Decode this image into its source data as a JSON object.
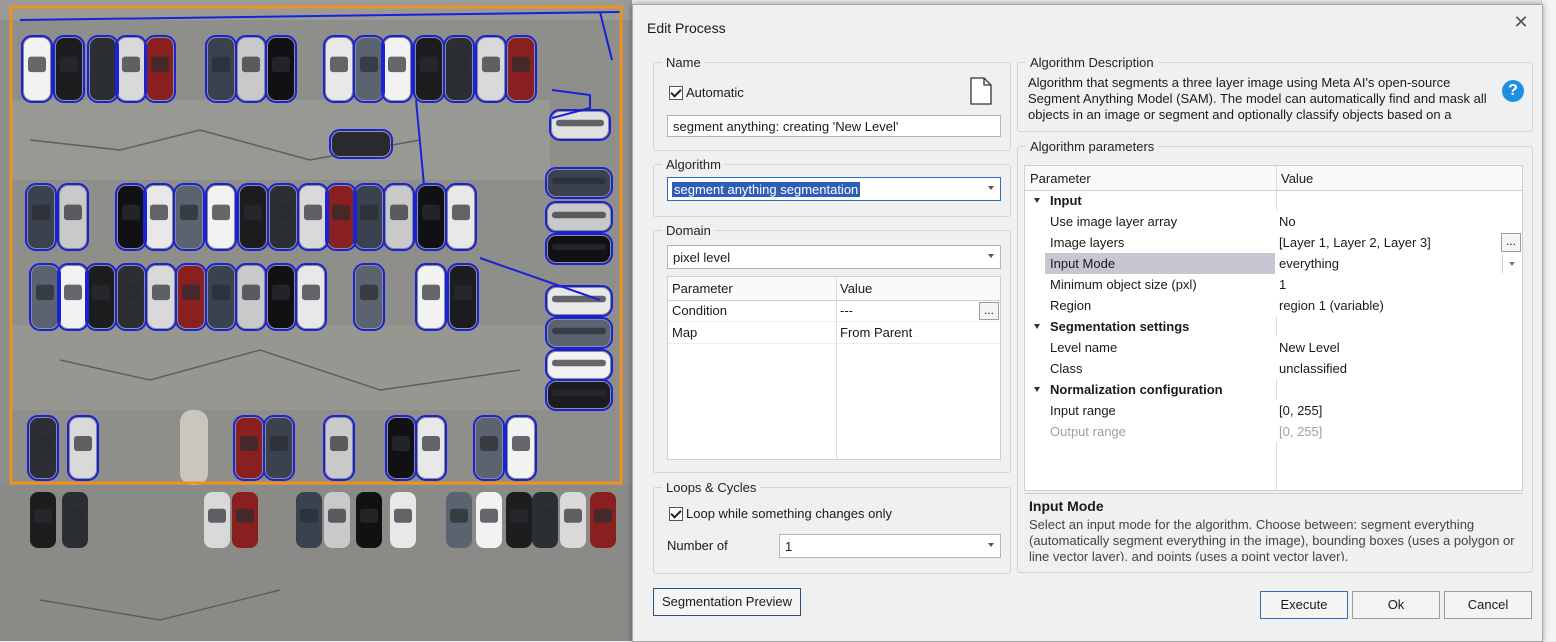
{
  "dialog": {
    "title": "Edit Process"
  },
  "name_group": {
    "legend": "Name",
    "automatic_label": "Automatic",
    "automatic_checked": true,
    "name_value": "segment anything: creating 'New Level'",
    "doc_icon": "document-icon"
  },
  "algorithm_group": {
    "legend": "Algorithm",
    "selected": "segment anything segmentation"
  },
  "domain_group": {
    "legend": "Domain",
    "selected": "pixel level",
    "columns": [
      "Parameter",
      "Value"
    ],
    "rows": [
      {
        "parameter": "Condition",
        "value": "---"
      },
      {
        "parameter": "Map",
        "value": "From Parent"
      }
    ],
    "ellipsis": "..."
  },
  "loops_group": {
    "legend": "Loops & Cycles",
    "loop_label": "Loop while something changes only",
    "loop_checked": true,
    "number_label": "Number of",
    "number_value": "1"
  },
  "description_group": {
    "legend": "Algorithm Description",
    "text": "Algorithm that segments a three layer image using Meta AI's open-source Segment Anything Model (SAM). The model can automatically find and mask all objects in an image or segment and optionally classify objects based on a",
    "help_icon": "question-mark-icon"
  },
  "params_group": {
    "legend": "Algorithm parameters",
    "columns": [
      "Parameter",
      "Value"
    ],
    "rows": [
      {
        "type": "category",
        "name": "Input"
      },
      {
        "type": "param",
        "name": "Use image layer array",
        "value": "No"
      },
      {
        "type": "param",
        "name": "Image layers",
        "value": "[Layer 1, Layer 2, Layer 3]",
        "ellipsis": "..."
      },
      {
        "type": "param",
        "name": "Input Mode",
        "value": "everything",
        "selected": true
      },
      {
        "type": "param",
        "name": "Minimum object size (pxl)",
        "value": "1"
      },
      {
        "type": "param",
        "name": "Region",
        "value": "region 1 (variable)"
      },
      {
        "type": "category",
        "name": "Segmentation settings"
      },
      {
        "type": "param",
        "name": "Level name",
        "value": "New Level"
      },
      {
        "type": "param",
        "name": "Class",
        "value": "unclassified"
      },
      {
        "type": "category",
        "name": "Normalization configuration"
      },
      {
        "type": "param",
        "name": "Input range",
        "value": "[0, 255]"
      },
      {
        "type": "param",
        "name": "Output range",
        "value": "[0, 255]",
        "disabled": true
      }
    ],
    "help_title": "Input Mode",
    "help_text": "Select an input mode for the algorithm. Choose between: segment everything (automatically segment everything in the image), bounding boxes (uses a polygon or line vector layer), and points (uses a point vector layer)."
  },
  "buttons": {
    "preview": "Segmentation Preview",
    "execute": "Execute",
    "ok": "Ok",
    "cancel": "Cancel"
  },
  "colors": {
    "map_border": "#f0901e",
    "segment_outline": "#1a22d8",
    "selection": "#2f5fb4",
    "help_blue": "#1e90e0"
  }
}
